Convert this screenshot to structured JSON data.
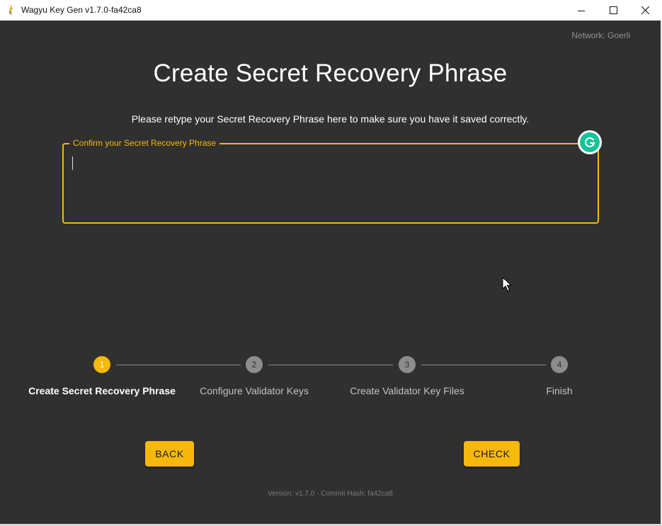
{
  "window": {
    "title": "Wagyu Key Gen v1.7.0-fa42ca8",
    "controls": [
      "minimize-icon",
      "maximize-icon",
      "close-icon"
    ]
  },
  "header": {
    "network": "Network: Goerli"
  },
  "main": {
    "title": "Create Secret Recovery Phrase",
    "instruction": "Please retype your Secret Recovery Phrase here to make sure you have it saved correctly.",
    "field": {
      "label": "Confirm your Secret Recovery Phrase",
      "value": "",
      "placeholder": ""
    }
  },
  "stepper": {
    "active_index": 0,
    "steps": [
      {
        "number": "1",
        "label": "Create Secret Recovery Phrase"
      },
      {
        "number": "2",
        "label": "Configure Validator Keys"
      },
      {
        "number": "3",
        "label": "Create Validator Key Files"
      },
      {
        "number": "4",
        "label": "Finish"
      }
    ]
  },
  "actions": {
    "back_label": "BACK",
    "check_label": "CHECK"
  },
  "footer": {
    "version": "Version: v1.7.0 - Commit Hash: fa42ca8"
  },
  "colors": {
    "accent": "#f5b80b",
    "background": "#303030",
    "grammarly": "#15c39a"
  }
}
